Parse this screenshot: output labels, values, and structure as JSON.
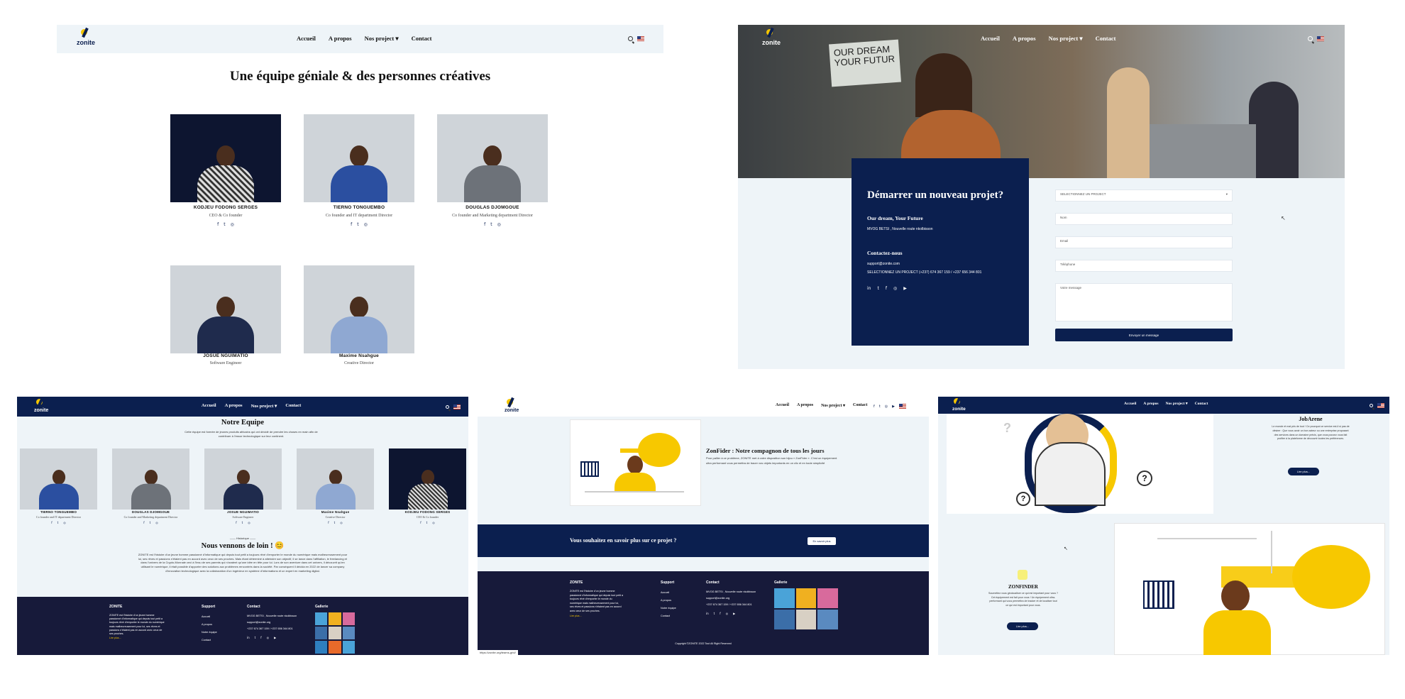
{
  "brand": {
    "logo_text": "zonite"
  },
  "nav": {
    "home": "Accueil",
    "about": "A propos",
    "projects": "Nos project",
    "contact": "Contact"
  },
  "team_page": {
    "title": "Une équipe géniale & des personnes créatives",
    "members": [
      {
        "name": "KODJEU FODONG SERGES",
        "role": "CEO & Co founder"
      },
      {
        "name": "TIERNO TONGUEMBO",
        "role": "Co founder and IT department Director"
      },
      {
        "name": "DOUGLAS DJOMGOUE",
        "role": "Co founder and Marketing department Director"
      },
      {
        "name": "JOSUE NGUIMATIO",
        "role": "Software Engineer"
      },
      {
        "name": "Maxime Nsahgue",
        "role": "Creative Director"
      }
    ]
  },
  "contact_page": {
    "hero_text": "OUR DREAM YOUR FUTUR",
    "title": "Démarrer un nouveau projet?",
    "tagline": "Our dream, Your Future",
    "address": "MVOG BETSI , Nouvelle route nkolbisson",
    "contact_heading": "Contactez-nous",
    "email": "support@zonite.com",
    "phones": "SELECTIONNEZ UN PROJECT (+237) 674 367 159 / +237 656 344 801",
    "select_placeholder": "SELECTIONNEZ UN PROJECT",
    "name_placeholder": "Nom",
    "email_placeholder": "Email",
    "phone_placeholder": "Téléphone",
    "message_placeholder": "Votre message",
    "submit": "Envoyer un message"
  },
  "about_page": {
    "title": "Notre Equipe",
    "intro": "Cette équipe est formée de jeunes produits africains qui ont décidé de prendre les choses en main afin de contribuer à l'essor technologique sur leur continent.",
    "more": "Historique",
    "history_title": "Nous vennons de loin ! 😊",
    "history_text": "ZONITE est l'histoire d'un jeune homme passionné d'informatique qui depuis tout petit a toujours rêvé d'emporter le monde du numérique mais malheureusement pour lui, ses rêves et passions n'étaient pas en accord avec ceux de ses proches. Mais étant déterminé à atteindre son objectif, il se lance dans l'affiliation, le freelancing et dans l'univers de la Crypto-Monnaie ceci à l'insu de ses parents qui n'avaient qu'une idée en tête pour lui. Lors de son aventure dans cet univers, il découvrit qu'en utilisant le numérique, il était possible d'apporter des solutions aux problèmes rencontrés dans la société. Par conséquent il décida en 2022 de lancer sa company d'innovation technologique avec la collaboration d'un ingénieur en système d'informations et un expert en marketing digital."
  },
  "footer": {
    "brand": "ZONITE",
    "about": "ZONITE est l'histoire d'un jeune homme passionné d'informatique qui depuis tout petit a toujours rêvé d'emporter le monde du numérique mais malheureusement pour lui, ses rêves et passions n'étaient pas en accord avec ceux de ses proches.",
    "read_more": "Lire plus...",
    "support_title": "Support",
    "support_links": [
      "Accueil",
      "A propos",
      "Notre équipe",
      "Contact"
    ],
    "contact_title": "Contact",
    "contact_lines": [
      "MVOG BETSI , Nouvelle route nkolbisson",
      "support@zonite.org",
      "+237 674 367 159 / +237 656 344 801"
    ],
    "gallery_title": "Gallerie",
    "copyright": "Copyright ©ZONITE 2022 Tout All Right Reserved",
    "status_url": "https://zonite.org/teams-grid/"
  },
  "project_page": {
    "zonfider_title": "ZonFider : Notre compagnon de tous les jours",
    "zonfider_text": "Pour pallier à ce problème, ZONITE met à votre disposition son bijou « ZonFider ». C'est un équipement ultra performant vous permettra de tracer vos objets importants en un clic et en toute simplicité",
    "cta_text": "Vous souhaitez en savoir plus sur ce projet ?",
    "cta_button": "En savoir plus"
  },
  "projects_list": {
    "jobarene_title": "JobArene",
    "jobarene_text": "Le monde et mal pris de tout ! Ce pourquoi ce service est-il si pas de désirer : Que vous avoir un bon acteur ou une entreprise proposant des services dans un domaine précis, que vous pouvez vous fait profiter à la plateforme de découvrir toutes les préférences.",
    "read_more": "Lire plus...",
    "zonfinder_title": "ZONFINDER",
    "zonfinder_text": "Soumettez vous géolocaliser ce qui est important pour vous ? Cet équipement est fait pour vous ! Un équipement ultra-performant qui vous permettra de tracker et de localiser tout ce qui est important pour vous."
  },
  "colors": {
    "navy": "#0b1f4f",
    "footer": "#171a3a",
    "light_bg": "#eef4f8",
    "accent": "#f3c400"
  }
}
